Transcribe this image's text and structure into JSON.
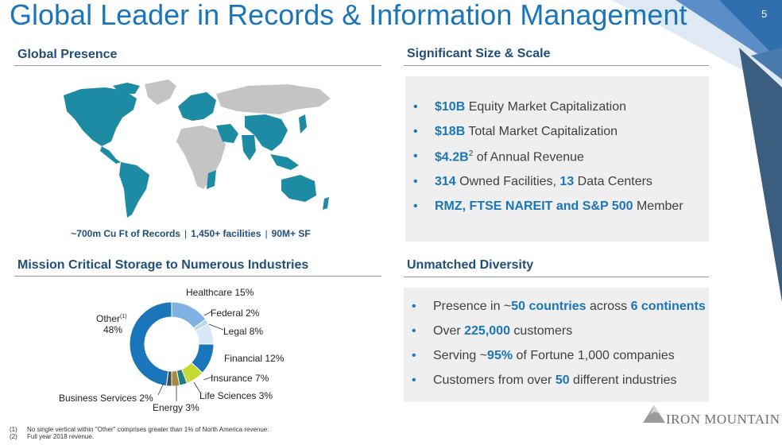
{
  "slide": {
    "title": "Global Leader in Records & Information Management",
    "page_number": "5",
    "accent_color": "#1b75bb",
    "heading_color": "#1f4e79"
  },
  "global_presence": {
    "heading": "Global Presence",
    "map_icon": "world-map",
    "caption": {
      "records": "~700m Cu Ft of Records",
      "facilities": "1,450+ facilities",
      "sf": "90M+ SF",
      "separator": "|"
    }
  },
  "size_scale": {
    "heading": "Significant Size & Scale",
    "bullet_glyph": "•",
    "items": [
      {
        "bold": "$10B",
        "text": " Equity Market Capitalization"
      },
      {
        "bold": "$18B",
        "text": " Total Market Capitalization"
      },
      {
        "bold": "$4.2B",
        "sup": "2",
        "text": " of Annual Revenue"
      },
      {
        "bold": "314",
        "text": " Owned Facilities, ",
        "bold2": "13",
        "text2": " Data Centers"
      },
      {
        "bold": "RMZ, FTSE NAREIT and S&P 500",
        "text": " Member"
      }
    ]
  },
  "mission": {
    "heading": "Mission Critical Storage to Numerous Industries",
    "other_label": "Other",
    "other_sup": "(1)",
    "other_value": "48%",
    "labels": {
      "healthcare": "Healthcare 15%",
      "federal": "Federal 2%",
      "legal": "Legal 8%",
      "financial": "Financial 12%",
      "insurance": "Insurance 7%",
      "life_sciences": "Life Sciences 3%",
      "energy": "Energy 3%",
      "business_services": "Business Services 2%"
    }
  },
  "chart_data": {
    "type": "pie",
    "donut": true,
    "categories": [
      "Healthcare",
      "Federal",
      "Legal",
      "Financial",
      "Insurance",
      "Life Sciences",
      "Energy",
      "Business Services",
      "Other"
    ],
    "values": [
      15,
      2,
      8,
      12,
      7,
      3,
      3,
      2,
      48
    ],
    "colors": [
      "#7fb2e2",
      "#bcd6ee",
      "#d7e7f6",
      "#1b75bb",
      "#c6d932",
      "#207d8a",
      "#a88a3a",
      "#3d4f5c",
      "#1b75bb"
    ]
  },
  "diversity": {
    "heading": "Unmatched Diversity",
    "bullet_glyph": "•",
    "items": [
      {
        "pre": "Presence in ~",
        "bold": "50 countries",
        "mid": " across ",
        "bold2": "6 continents",
        "post": ""
      },
      {
        "pre": "Over ",
        "bold": "225,000",
        "mid": " customers",
        "bold2": "",
        "post": ""
      },
      {
        "pre": "Serving ~",
        "bold": "95%",
        "mid": " of Fortune 1,000 companies",
        "bold2": "",
        "post": ""
      },
      {
        "pre": "Customers from over ",
        "bold": "50",
        "mid": " different industries",
        "bold2": "",
        "post": ""
      }
    ]
  },
  "footnotes": [
    {
      "num": "(1)",
      "text": "No single vertical within \"Other\" comprises greater than 1% of North America revenue."
    },
    {
      "num": "(2)",
      "text": "Full year 2018 revenue."
    }
  ],
  "logo": {
    "text": "IRON MOUNTAIN",
    "icon": "mountain-logo-icon"
  }
}
